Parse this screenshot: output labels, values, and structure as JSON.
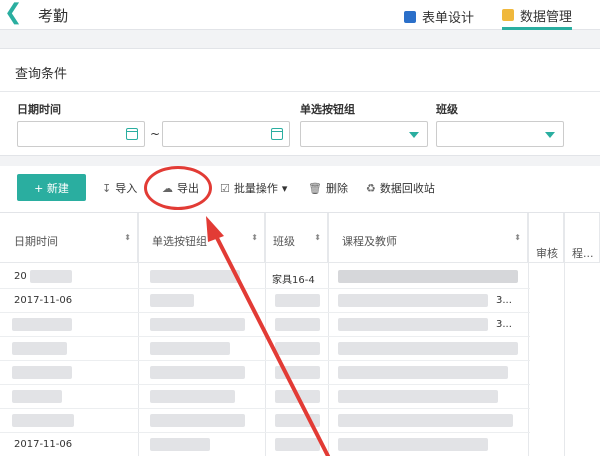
{
  "header": {
    "back_icon": "chevron-left-icon",
    "title": "考勤",
    "tabs": [
      {
        "label": "表单设计",
        "icon": "form-icon"
      },
      {
        "label": "数据管理",
        "icon": "chart-icon",
        "active": true
      }
    ],
    "accent": "#2aaea0"
  },
  "query": {
    "title": "查询条件",
    "fields": [
      {
        "label": "日期时间",
        "separator": "~"
      },
      {
        "label": "单选按钮组"
      },
      {
        "label": "班级"
      }
    ]
  },
  "toolbar": {
    "new": "+ 新建",
    "import": "导入",
    "export": "导出",
    "batch": "批量操作",
    "batch_caret": "▾",
    "delete": "删除",
    "recycle": "数据回收站"
  },
  "annotation": {
    "color": "#e23b35"
  },
  "table": {
    "columns": [
      "日期时间",
      "单选按钮组",
      "班级",
      "课程及教师",
      "审核",
      "程..."
    ],
    "sort_glyph": "⬍",
    "rows": [
      {
        "date": "20",
        "class": "家具16-4",
        "tail": ""
      },
      {
        "date": "2017-11-06",
        "class": "",
        "tail": "3..."
      },
      {
        "date": "",
        "class": "",
        "tail": "3..."
      },
      {
        "date": "",
        "class": "",
        "tail": ""
      },
      {
        "date": "",
        "class": "",
        "tail": ""
      },
      {
        "date": "",
        "class": "",
        "tail": ""
      },
      {
        "date": "2017-11-06",
        "class": "",
        "tail": ""
      }
    ]
  }
}
